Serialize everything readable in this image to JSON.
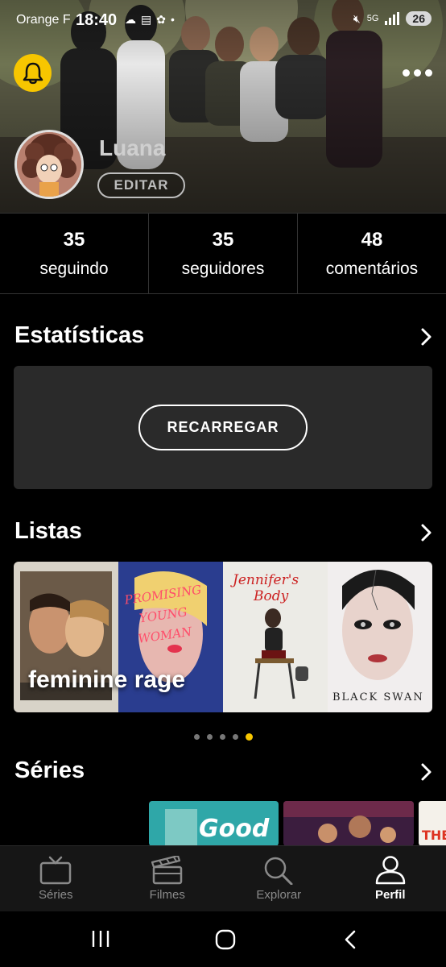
{
  "status_bar": {
    "carrier": "Orange F",
    "time": "18:40",
    "network": "5G",
    "battery": "26"
  },
  "profile": {
    "username": "Luana",
    "edit_label": "EDITAR"
  },
  "stats": [
    {
      "value": "35",
      "label": "seguindo"
    },
    {
      "value": "35",
      "label": "seguidores"
    },
    {
      "value": "48",
      "label": "comentários"
    }
  ],
  "statistics_section": {
    "title": "Estatísticas",
    "reload_label": "RECARREGAR"
  },
  "lists_section": {
    "title": "Listas",
    "list_name": "feminine rage",
    "posters": [
      {
        "name": "poster-1",
        "text": ""
      },
      {
        "name": "poster-promising-young-woman",
        "text": "PROMISING YOUNG WOMAN"
      },
      {
        "name": "poster-jennifers-body",
        "text": "Jennifer's Body"
      },
      {
        "name": "poster-black-swan",
        "text": "BLACK SWAN"
      }
    ],
    "carousel_pages": 5,
    "carousel_active": 5
  },
  "series_section": {
    "title": "Séries",
    "thumbs": [
      "Good",
      "",
      "THE"
    ]
  },
  "bottom_nav": [
    {
      "label": "Séries",
      "icon": "tv-icon"
    },
    {
      "label": "Filmes",
      "icon": "clapperboard-icon"
    },
    {
      "label": "Explorar",
      "icon": "search-icon"
    },
    {
      "label": "Perfil",
      "icon": "person-icon",
      "active": true
    }
  ],
  "colors": {
    "accent": "#f7c600",
    "card_bg": "#2a2a2a",
    "nav_bg": "#161616"
  }
}
